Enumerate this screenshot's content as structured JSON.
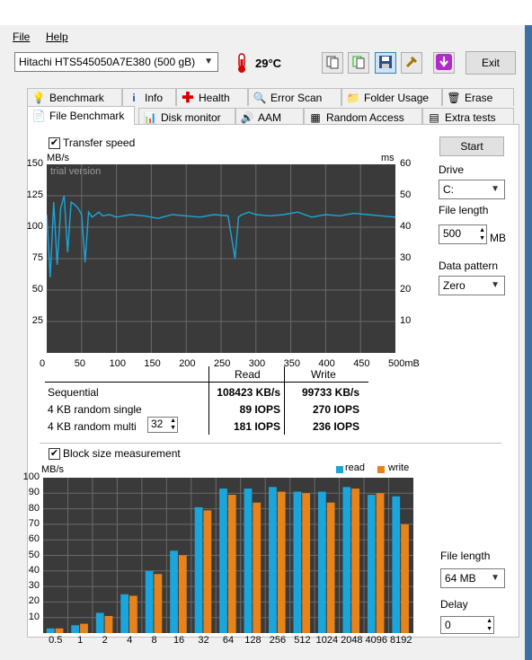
{
  "menu": {
    "file": "File",
    "help": "Help"
  },
  "toolbar": {
    "disk": "Hitachi HTS545050A7E380 (500 gB)",
    "temperature": "29°C",
    "exit": "Exit"
  },
  "tabs_row1": [
    "Benchmark",
    "Info",
    "Health",
    "Error Scan",
    "Folder Usage",
    "Erase"
  ],
  "tabs_row2": [
    "File Benchmark",
    "Disk monitor",
    "AAM",
    "Random Access",
    "Extra tests"
  ],
  "active_tab": "File Benchmark",
  "transfer": {
    "checkbox_label": "Transfer speed",
    "checked": true,
    "unit_left": "MB/s",
    "unit_right": "ms",
    "watermark": "trial version",
    "y_left_ticks": [
      "150",
      "125",
      "100",
      "75",
      "50",
      "25"
    ],
    "y_right_ticks": [
      "60",
      "50",
      "40",
      "30",
      "20",
      "10"
    ],
    "x_ticks": [
      "0",
      "50",
      "100",
      "150",
      "200",
      "250",
      "300",
      "350",
      "400",
      "450",
      "500mB"
    ]
  },
  "results": {
    "col_read": "Read",
    "col_write": "Write",
    "rows": [
      {
        "label": "Sequential",
        "read": "108423 KB/s",
        "write": "99733 KB/s"
      },
      {
        "label": "4 KB random single",
        "read": "89 IOPS",
        "write": "270 IOPS"
      },
      {
        "label": "4 KB random multi",
        "read": "181 IOPS",
        "write": "236 IOPS"
      }
    ],
    "queue_depth": "32"
  },
  "right_panel": {
    "start": "Start",
    "drive_label": "Drive",
    "drive_value": "C:",
    "file_length_label": "File length",
    "file_length_value": "500",
    "file_length_unit": "MB",
    "pattern_label": "Data pattern",
    "pattern_value": "Zero"
  },
  "block": {
    "checkbox_label": "Block size measurement",
    "checked": true,
    "file_length_label": "File length",
    "file_length_value": "64 MB",
    "delay_label": "Delay",
    "delay_value": "0"
  },
  "colors": {
    "read": "#1aa6dc",
    "write": "#e8821a",
    "plot_bg": "#3a3a3a"
  },
  "chart_data": [
    {
      "type": "line",
      "title": "Transfer speed",
      "xlabel": "mB",
      "ylabel": "MB/s",
      "y2label": "ms",
      "xlim": [
        0,
        500
      ],
      "ylim": [
        0,
        150
      ],
      "y2lim": [
        0,
        60
      ],
      "series": [
        {
          "name": "read",
          "x": [
            0,
            5,
            10,
            15,
            20,
            25,
            30,
            35,
            40,
            45,
            50,
            55,
            60,
            65,
            70,
            75,
            80,
            90,
            100,
            120,
            140,
            160,
            180,
            200,
            220,
            240,
            260,
            270,
            275,
            280,
            290,
            300,
            320,
            340,
            360,
            380,
            400,
            420,
            440,
            460,
            480,
            500
          ],
          "y": [
            110,
            60,
            120,
            70,
            115,
            125,
            80,
            120,
            118,
            115,
            110,
            72,
            112,
            108,
            110,
            112,
            109,
            110,
            108,
            110,
            109,
            107,
            110,
            109,
            108,
            110,
            109,
            75,
            108,
            110,
            112,
            110,
            109,
            110,
            112,
            108,
            110,
            109,
            111,
            110,
            109,
            108
          ]
        }
      ]
    },
    {
      "type": "bar",
      "title": "Block size measurement",
      "ylabel": "MB/s",
      "ylim": [
        0,
        100
      ],
      "categories": [
        "0.5",
        "1",
        "2",
        "4",
        "8",
        "16",
        "32",
        "64",
        "128",
        "256",
        "512",
        "1024",
        "2048",
        "4096",
        "8192"
      ],
      "series": [
        {
          "name": "read",
          "values": [
            3,
            5,
            13,
            25,
            40,
            53,
            81,
            93,
            93,
            94,
            91,
            91,
            94,
            89,
            88
          ]
        },
        {
          "name": "write",
          "values": [
            3,
            6,
            11,
            24,
            38,
            50,
            79,
            89,
            84,
            91,
            90,
            84,
            93,
            90,
            70
          ]
        }
      ]
    }
  ]
}
